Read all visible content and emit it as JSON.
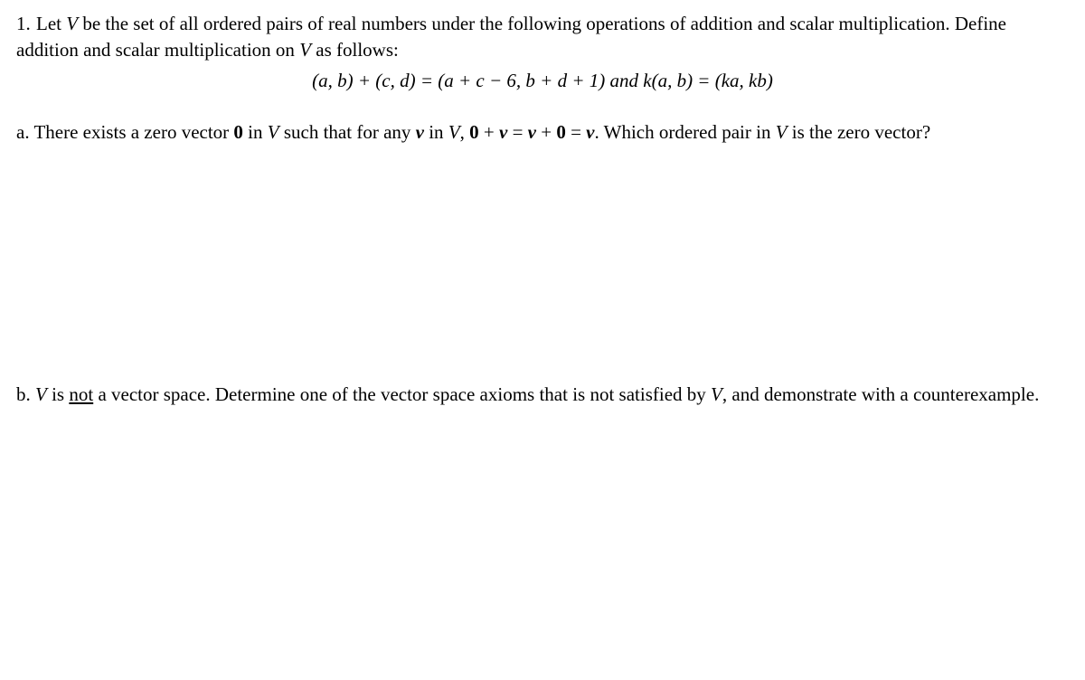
{
  "problem": {
    "number": "1.",
    "dots": "   ",
    "intro1": " Let ",
    "V": "V",
    "intro2": " be the set of all ordered pairs of real numbers under the following operations of addition and scalar multiplication.  Define addition and scalar multiplication on ",
    "intro3": " as follows:",
    "equation": "(a, b) + (c, d) = (a + c − 6,  b + d + 1) and k(a, b) = (ka, kb)"
  },
  "partA": {
    "label": "a.  There exists a zero vector ",
    "zero": "0",
    "text1": " in ",
    "V": "V",
    "text2": " such that for any ",
    "v": "v",
    "text3": " in ",
    "text4": ", ",
    "eq1": "0 + v = v + 0 = v",
    "text5": ".  Which ordered pair in ",
    "text6": " is the zero vector?"
  },
  "partB": {
    "label": "b.  ",
    "V": "V",
    "text1": " is ",
    "not": "not",
    "text2": " a vector space.  Determine one of the vector space axioms that is not satisfied by ",
    "text3": ", and demonstrate with a counterexample."
  }
}
